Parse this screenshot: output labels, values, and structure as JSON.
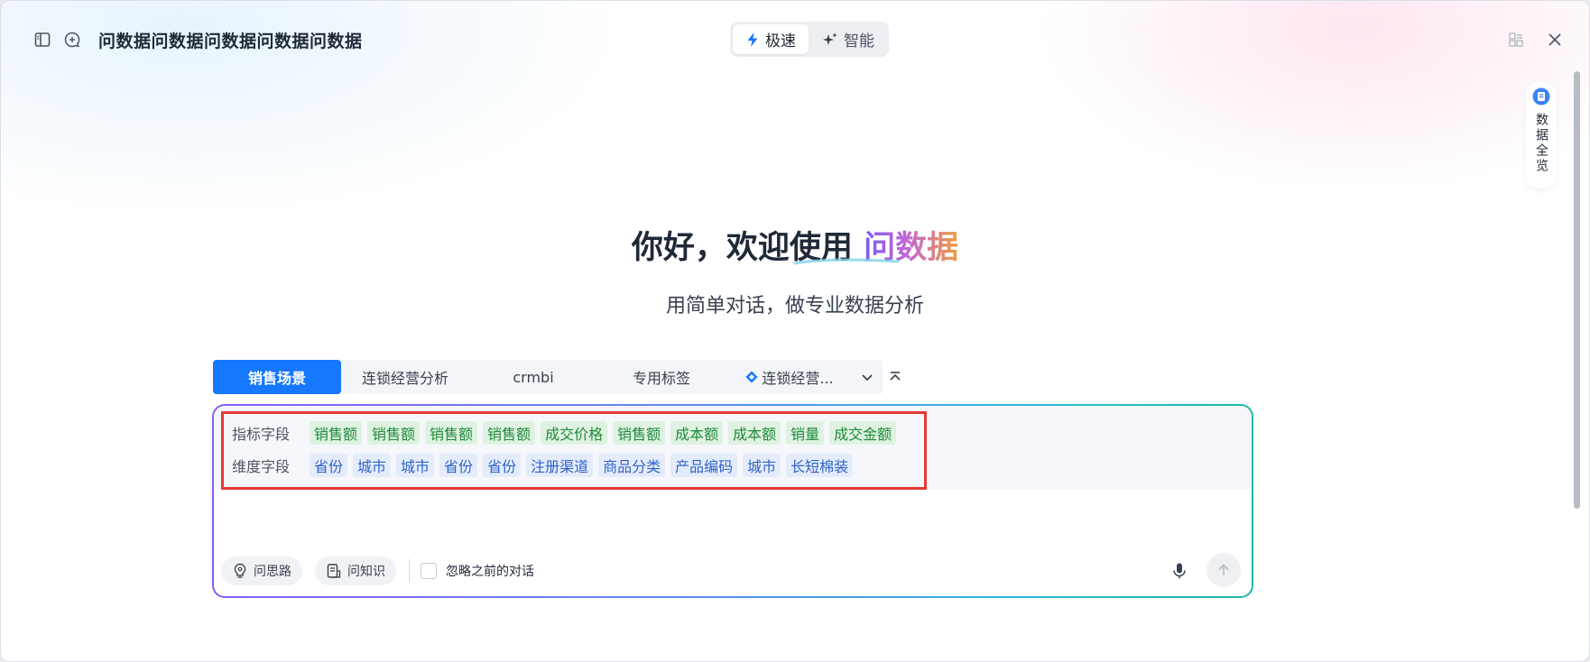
{
  "window": {
    "title": "问数据问数据问数据问数据问数据",
    "icons": [
      "sidebar-toggle-icon",
      "new-chat-icon",
      "layout-icon",
      "close-icon"
    ]
  },
  "mode_switch": {
    "fast_label": "极速",
    "smart_label": "智能",
    "active": "极速",
    "accent": "#1677ff"
  },
  "overview_panel": {
    "label": "数据全览"
  },
  "hero": {
    "title_prefix": "你好，欢迎使用",
    "title_brand": "问数据",
    "subtitle": "用简单对话，做专业数据分析"
  },
  "scene_tabs": {
    "items": [
      {
        "label": "销售场景",
        "active": true
      },
      {
        "label": "连锁经营分析",
        "active": false
      },
      {
        "label": "crmbi",
        "active": false
      },
      {
        "label": "专用标签",
        "active": false
      },
      {
        "label": "连锁经营...",
        "active": false,
        "icon": "diamond-icon"
      }
    ]
  },
  "fields": {
    "metric_label": "指标字段",
    "metrics": [
      "销售额",
      "销售额",
      "销售额",
      "销售额",
      "成交价格",
      "销售额",
      "成本额",
      "成本额",
      "销量",
      "成交金额"
    ],
    "dimension_label": "维度字段",
    "dimensions": [
      "省份",
      "城市",
      "城市",
      "省份",
      "省份",
      "注册渠道",
      "商品分类",
      "产品编码",
      "城市",
      "长短棉装"
    ]
  },
  "input_toolbar": {
    "idea_label": "问思路",
    "knowledge_label": "问知识",
    "ignore_history_label": "忽略之前的对话",
    "ignore_history_checked": false
  },
  "colors": {
    "metric_chip_bg": "#dff2e1",
    "metric_chip_text": "#1f8a3b",
    "dimension_chip_bg": "#e4ecfb",
    "dimension_chip_text": "#2f63c9",
    "highlight_box": "#e53935"
  }
}
